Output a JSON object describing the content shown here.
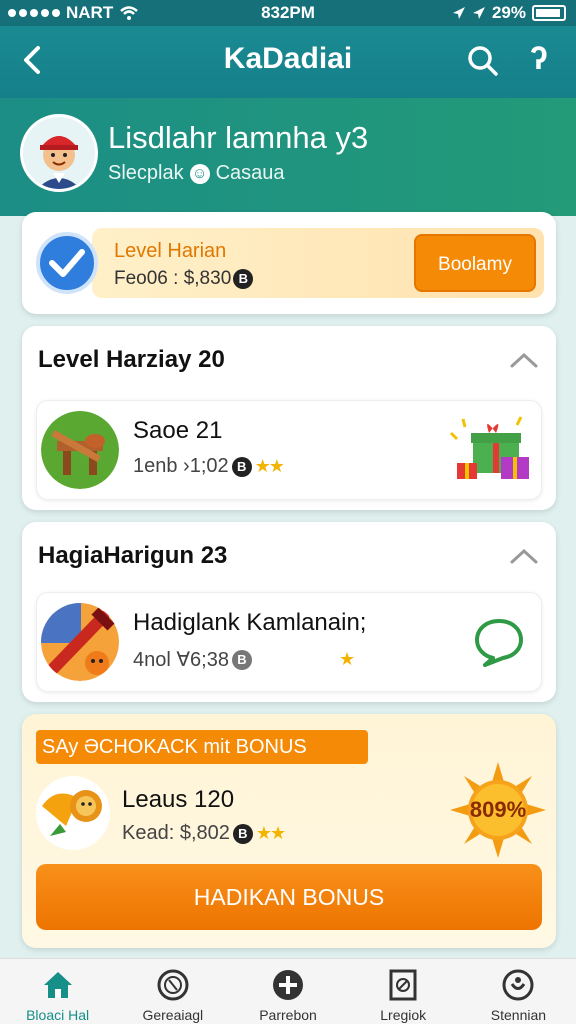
{
  "status_bar": {
    "carrier": "NART",
    "time": "832PM",
    "battery": "29%"
  },
  "header": {
    "title": "KaDadiai"
  },
  "profile": {
    "name": "Lisdlahr lamnha y3",
    "subtitle_left": "Slecplak",
    "subtitle_right": "Casaua"
  },
  "level_banner": {
    "title": "Level Harian",
    "subtitle": "Feo06 : $,830",
    "coin": "B",
    "button": "Boolamy"
  },
  "section1": {
    "title": "Level Harziay 20",
    "item": {
      "title": "Saoe 21",
      "subtitle": "1enb ›1;02",
      "coin": "B",
      "stars": "★★"
    }
  },
  "section2": {
    "title": "HagiaHarigun 23",
    "item": {
      "title": "Hadiglank Kamlanain;",
      "subtitle": "4nol ∀6;38",
      "coin": "B",
      "stars": "★"
    }
  },
  "bonus": {
    "ribbon": "SAy ƏCHOKACK mit BONUS",
    "title": "Leaus 120",
    "subtitle": "Kead: $,802",
    "coin": "B",
    "stars": "★★",
    "badge": "809%",
    "button": "HADIKAN BONUS"
  },
  "tabs": [
    {
      "label": "Bloaci Hal",
      "icon": "home-icon",
      "active": true
    },
    {
      "label": "Gereaiagl",
      "icon": "globe-icon",
      "active": false
    },
    {
      "label": "Parrebon",
      "icon": "plus-circle-icon",
      "active": false
    },
    {
      "label": "Lregiok",
      "icon": "document-icon",
      "active": false
    },
    {
      "label": "Stennian",
      "icon": "settings-icon",
      "active": false
    }
  ],
  "colors": {
    "primary": "#15808a",
    "accent": "#f58a07",
    "header_green": "#239a78"
  }
}
